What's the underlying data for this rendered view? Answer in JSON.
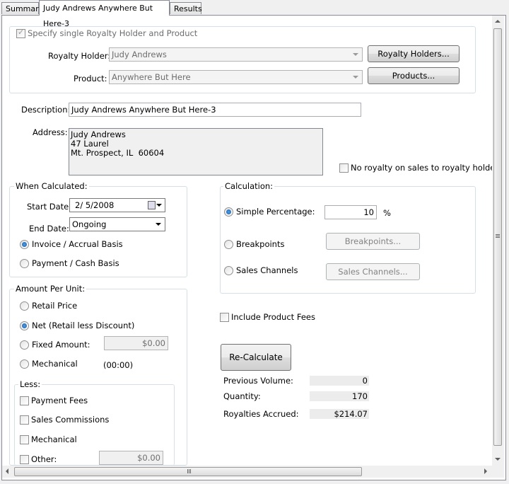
{
  "tabs": [
    "Summary",
    "Judy Andrews Anywhere But Here-3",
    "Results"
  ],
  "specify": {
    "label": "Specify single Royalty Holder and Product",
    "checked": true
  },
  "royalty_holder": {
    "label": "Royalty Holder:",
    "value": "Judy Andrews",
    "button": "Royalty Holders..."
  },
  "product": {
    "label": "Product:",
    "value": "Anywhere But Here",
    "button": "Products..."
  },
  "description": {
    "label": "Description:",
    "value": "Judy Andrews Anywhere But Here-3"
  },
  "address": {
    "label": "Address:",
    "value": "Judy Andrews\n47 Laurel\nMt. Prospect, IL  60604"
  },
  "no_royalty": {
    "label": "No royalty on sales to royalty holder",
    "checked": false
  },
  "when_calculated": {
    "title": "When Calculated:",
    "start_label": "Start Date:",
    "start_value": "2/  5/2008",
    "end_label": "End Date:",
    "end_value": "Ongoing",
    "invoice": "Invoice / Accrual Basis",
    "payment": "Payment / Cash Basis"
  },
  "calculation": {
    "title": "Calculation:",
    "simple": "Simple Percentage:",
    "simple_value": "10",
    "percent": "%",
    "breakpoints": "Breakpoints",
    "breakpoints_button": "Breakpoints...",
    "sales_channels": "Sales Channels",
    "sales_channels_button": "Sales Channels..."
  },
  "include_fees": {
    "label": "Include Product Fees",
    "checked": false
  },
  "amount_per_unit": {
    "title": "Amount Per Unit:",
    "retail": "Retail Price",
    "net": "Net (Retail less Discount)",
    "fixed": "Fixed Amount:",
    "fixed_value": "$0.00",
    "mechanical": "Mechanical",
    "mechanical_value": "(00:00)"
  },
  "less": {
    "title": "Less:",
    "payment_fees": "Payment Fees",
    "sales_commissions": "Sales Commissions",
    "mechanical": "Mechanical",
    "other": "Other:",
    "other_value": "$0.00"
  },
  "recalc_button": "Re-Calculate",
  "results": {
    "previous_label": "Previous Volume:",
    "previous_value": "0",
    "quantity_label": "Quantity:",
    "quantity_value": "170",
    "royalties_label": "Royalties Accrued:",
    "royalties_value": "$214.07"
  }
}
